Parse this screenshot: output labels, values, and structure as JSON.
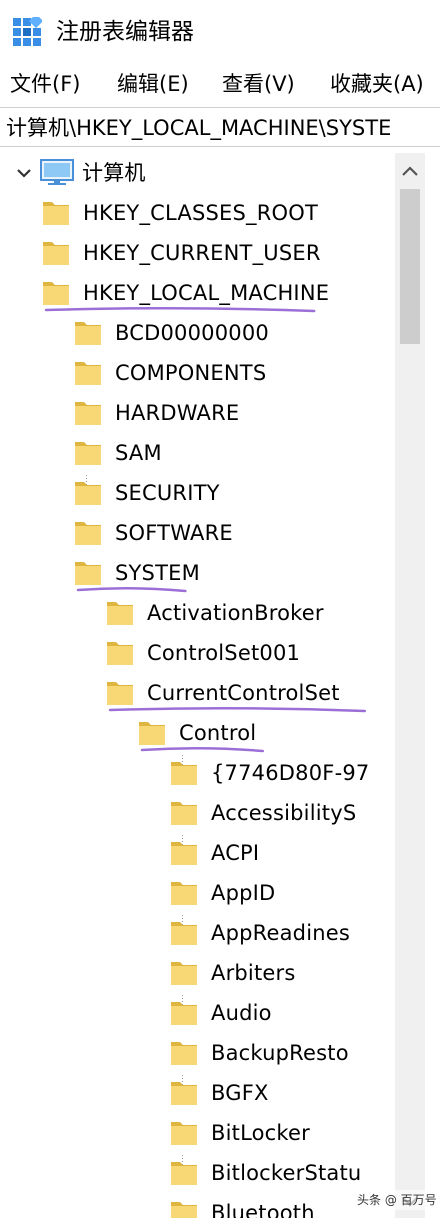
{
  "window": {
    "title": "注册表编辑器",
    "icon": "regedit-icon"
  },
  "menu": {
    "items": [
      {
        "label": "文件(F)"
      },
      {
        "label": "编辑(E)"
      },
      {
        "label": "查看(V)"
      },
      {
        "label": "收藏夹(A)"
      }
    ]
  },
  "address": {
    "path": "计算机\\HKEY_LOCAL_MACHINE\\SYSTE"
  },
  "tree": {
    "root": {
      "label": "计算机",
      "expanded": true
    },
    "nodes": [
      {
        "label": "HKEY_CLASSES_ROOT",
        "depth": 1,
        "state": "collapsed"
      },
      {
        "label": "HKEY_CURRENT_USER",
        "depth": 1,
        "state": "collapsed"
      },
      {
        "label": "HKEY_LOCAL_MACHINE",
        "depth": 1,
        "state": "expanded",
        "highlighted": true
      },
      {
        "label": "BCD00000000",
        "depth": 2,
        "state": "collapsed"
      },
      {
        "label": "COMPONENTS",
        "depth": 2,
        "state": "collapsed"
      },
      {
        "label": "HARDWARE",
        "depth": 2,
        "state": "collapsed"
      },
      {
        "label": "SAM",
        "depth": 2,
        "state": "collapsed"
      },
      {
        "label": "SECURITY",
        "depth": 2,
        "state": "leaf"
      },
      {
        "label": "SOFTWARE",
        "depth": 2,
        "state": "collapsed"
      },
      {
        "label": "SYSTEM",
        "depth": 2,
        "state": "expanded",
        "highlighted": true
      },
      {
        "label": "ActivationBroker",
        "depth": 3,
        "state": "collapsed"
      },
      {
        "label": "ControlSet001",
        "depth": 3,
        "state": "collapsed"
      },
      {
        "label": "CurrentControlSet",
        "depth": 3,
        "state": "expanded",
        "highlighted": true
      },
      {
        "label": "Control",
        "depth": 4,
        "state": "expanded",
        "highlighted": true
      },
      {
        "label": "{7746D80F-97",
        "depth": 5,
        "state": "leaf"
      },
      {
        "label": "AccessibilityS",
        "depth": 5,
        "state": "collapsed"
      },
      {
        "label": "ACPI",
        "depth": 5,
        "state": "leaf"
      },
      {
        "label": "AppID",
        "depth": 5,
        "state": "collapsed"
      },
      {
        "label": "AppReadines",
        "depth": 5,
        "state": "leaf"
      },
      {
        "label": "Arbiters",
        "depth": 5,
        "state": "collapsed"
      },
      {
        "label": "Audio",
        "depth": 5,
        "state": "leaf"
      },
      {
        "label": "BackupResto",
        "depth": 5,
        "state": "collapsed"
      },
      {
        "label": "BGFX",
        "depth": 5,
        "state": "leaf"
      },
      {
        "label": "BitLocker",
        "depth": 5,
        "state": "collapsed"
      },
      {
        "label": "BitlockerStatu",
        "depth": 5,
        "state": "leaf"
      },
      {
        "label": "Bluetooth",
        "depth": 5,
        "state": "collapsed"
      }
    ]
  },
  "annotation": {
    "color": "#9b6fd6"
  },
  "colors": {
    "folder_fill": "#f8d775",
    "folder_edge": "#e0b441",
    "chevron": "#6b6b6b",
    "expanded_chevron": "#333333"
  },
  "watermark": {
    "text": "头条 @ 百万号"
  }
}
